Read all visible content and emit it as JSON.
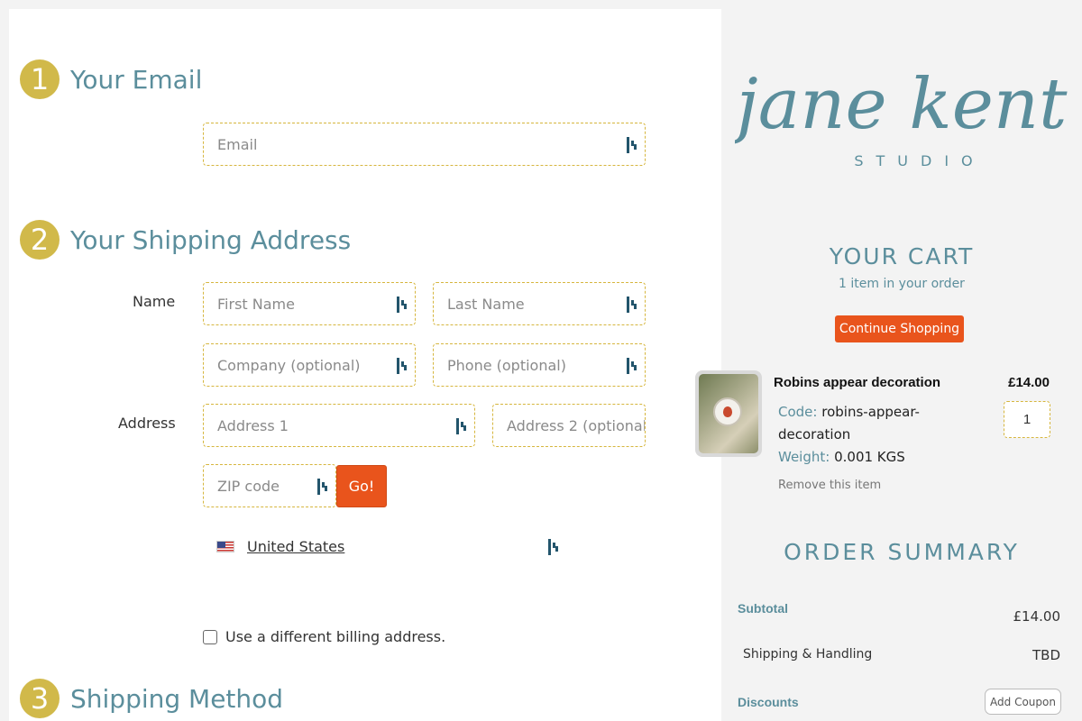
{
  "steps": [
    {
      "number": "1",
      "title": "Your Email"
    },
    {
      "number": "2",
      "title": "Your Shipping Address"
    },
    {
      "number": "3",
      "title": "Shipping Method"
    }
  ],
  "email": {
    "placeholder": "Email"
  },
  "shipping": {
    "name_label": "Name",
    "address_label": "Address",
    "first_name": "First Name",
    "last_name": "Last Name",
    "company": "Company (optional)",
    "phone": "Phone (optional)",
    "address1": "Address 1",
    "address2": "Address 2 (optional",
    "zip": "ZIP code",
    "go_label": "Go!",
    "country": "United States"
  },
  "billing": {
    "label": "Use a different billing address.",
    "checked": false
  },
  "brand": {
    "script": "jane kent",
    "sub": "STUDIO",
    "color": "#5b8e9c"
  },
  "cart": {
    "title": "YOUR CART",
    "count": "1 item in your order",
    "continue_label": "Continue Shopping",
    "item": {
      "name": "Robins appear decoration",
      "price": "£14.00",
      "code_label": "Code:",
      "code_value_1": "robins-appear-",
      "code_value_2": "decoration",
      "weight_label": "Weight:",
      "weight_value": "0.001 KGS",
      "quantity": "1",
      "remove_label": "Remove this item"
    }
  },
  "summary": {
    "title": "ORDER SUMMARY",
    "subtotal_label": "Subtotal",
    "subtotal_value": "£14.00",
    "shipping_label": "Shipping & Handling",
    "shipping_value": "TBD",
    "discounts_label": "Discounts",
    "coupon_label": "Add Coupon"
  },
  "colors": {
    "accent": "#e9541c",
    "step_circle": "#d1b94a",
    "teal": "#5b8e9c",
    "field_border": "#d6b63e"
  }
}
